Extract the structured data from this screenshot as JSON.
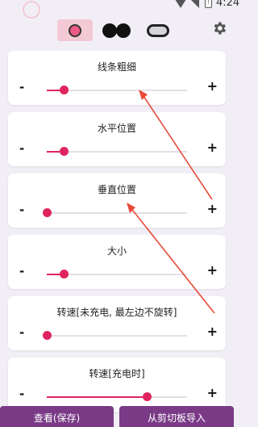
{
  "status_bar": {
    "time": "4:24",
    "battery_text": "!"
  },
  "toolbar": {
    "modes": [
      "single-dot",
      "double-dot",
      "pill"
    ],
    "selected_mode": "single-dot",
    "settings_icon": "gear-icon"
  },
  "settings": [
    {
      "label": "线条粗细",
      "minus": "-",
      "plus": "+",
      "value_fraction": 0.12
    },
    {
      "label": "水平位置",
      "minus": "-",
      "plus": "+",
      "value_fraction": 0.12
    },
    {
      "label": "垂直位置",
      "minus": "-",
      "plus": "+",
      "value_fraction": 0.0
    },
    {
      "label": "大小",
      "minus": "-",
      "plus": "+",
      "value_fraction": 0.12
    },
    {
      "label": "转速[未充电, 最左边不旋转]",
      "minus": "-",
      "plus": "+",
      "value_fraction": 0.0
    },
    {
      "label": "转速[充电时]",
      "minus": "-",
      "plus": "+",
      "value_fraction": 0.71
    }
  ],
  "bottom": {
    "view_label": "查看(保存)",
    "import_label": "从剪切板导入"
  },
  "colors": {
    "accent": "#e0245e",
    "button": "#7a3a86",
    "selected_bg": "#f3c9d5",
    "annotation": "#e84a3a"
  }
}
